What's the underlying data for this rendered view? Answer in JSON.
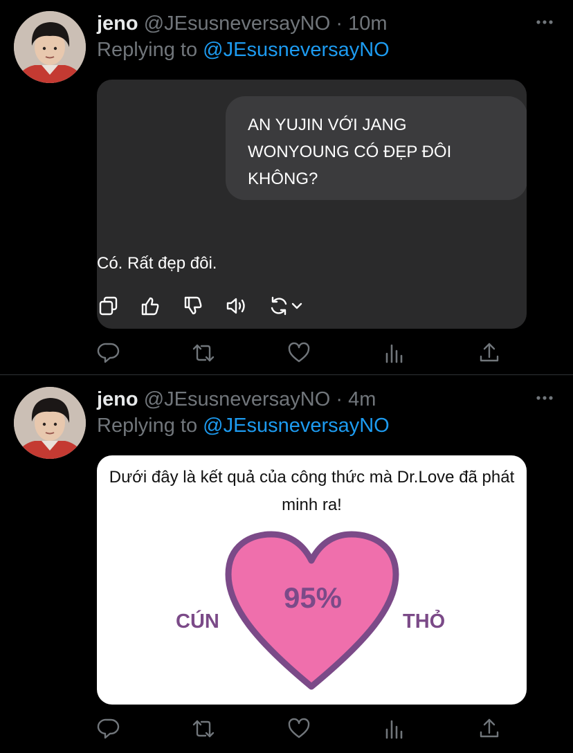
{
  "colors": {
    "background": "#000000",
    "name": "#e7e9ea",
    "secondary": "#71767b",
    "mention": "#1d9bf0",
    "divider": "#2f3336",
    "heart_fill": "#ef6fac",
    "heart_stroke": "#7b4a88"
  },
  "tweets": [
    {
      "name": "jeno",
      "handle": "@JEsusneversayNO",
      "separator": "·",
      "time": "10m",
      "replying_prefix": "Replying to",
      "replying_to": "@JEsusneversayNO",
      "media": {
        "type": "chat-screenshot",
        "question": "AN YUJIN VỚI JANG WONYOUNG CÓ ĐẸP ĐÔI KHÔNG?",
        "answer": "Có. Rất đẹp đôi.",
        "tool_icons": [
          "copy-icon",
          "thumbs-up-icon",
          "thumbs-down-icon",
          "speaker-icon",
          "regenerate-icon",
          "chevron-down-icon"
        ]
      },
      "actions": [
        "reply-icon",
        "retweet-icon",
        "like-icon",
        "analytics-icon",
        "share-icon"
      ]
    },
    {
      "name": "jeno",
      "handle": "@JEsusneversayNO",
      "separator": "·",
      "time": "4m",
      "replying_prefix": "Replying to",
      "replying_to": "@JEsusneversayNO",
      "media": {
        "type": "love-result-card",
        "caption": "Dưới đây là kết quả của công thức mà Dr.Love đã phát minh ra!",
        "percent": "95%",
        "left_name": "CÚN",
        "right_name": "THỎ"
      },
      "actions": [
        "reply-icon",
        "retweet-icon",
        "like-icon",
        "analytics-icon",
        "share-icon"
      ]
    }
  ]
}
